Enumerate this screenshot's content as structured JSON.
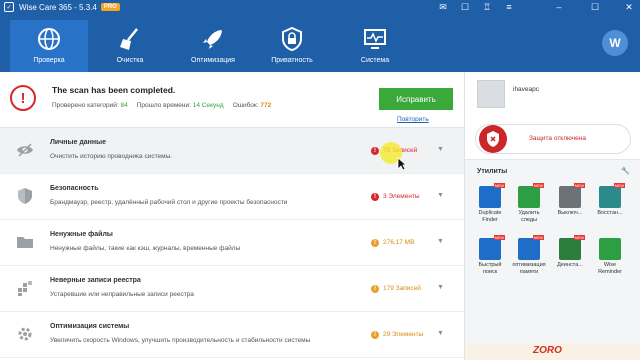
{
  "window": {
    "title": "Wise Care 365 - 5.3.4",
    "edition": "PRO",
    "controls": [
      "mail-icon",
      "chat-icon",
      "shirt-icon",
      "menu-icon",
      "minimize-icon",
      "maximize-icon",
      "close-icon"
    ]
  },
  "nav": {
    "tabs": [
      {
        "label": "Проверка",
        "icon": "globe-scan-icon",
        "active": true
      },
      {
        "label": "Очистка",
        "icon": "broom-icon",
        "active": false
      },
      {
        "label": "Оптимизация",
        "icon": "rocket-icon",
        "active": false
      },
      {
        "label": "Приватность",
        "icon": "lock-shield-icon",
        "active": false
      },
      {
        "label": "Система",
        "icon": "monitor-pulse-icon",
        "active": false
      }
    ],
    "brand_letter": "W"
  },
  "summary": {
    "title": "The scan has been completed.",
    "checked_label": "Проверено категорий:",
    "checked_value": "84",
    "time_label": "Прошло времени:",
    "time_value": "14 Секунд",
    "errors_label": "Ошибок:",
    "errors_value": "772",
    "fix_button": "Исправить",
    "rescan_link": "Повторить"
  },
  "categories": [
    {
      "title": "Личные данные",
      "desc": "Очистить историю проводника системы.",
      "count": "75 Записей",
      "severity": "red"
    },
    {
      "title": "Безопасность",
      "desc": "Брандмауэр, реестр, удалённый рабочий стол и другие проекты безопасности",
      "count": "3 Элементы",
      "severity": "red"
    },
    {
      "title": "Ненужные файлы",
      "desc": "Ненужные файлы, такие как кэш, журналы, временные файлы",
      "count": "276,17 MB",
      "severity": "orange"
    },
    {
      "title": "Неверные записи реестра",
      "desc": "Устаревшие или неправильные записи реестра",
      "count": "179 Записей",
      "severity": "orange"
    },
    {
      "title": "Оптимизация системы",
      "desc": "Увеличить скорость Windows, улучшить производительность и стабильности системы",
      "count": "29 Элементы",
      "severity": "orange"
    }
  ],
  "sidebar": {
    "username": "ihaveapc",
    "protection_status": "Защита отключена",
    "utilities_title": "Утилиты",
    "utilities": [
      {
        "label": "Duplicate Finder",
        "icon": "duplicate-finder-icon",
        "color": "#1e6ec8",
        "new": true
      },
      {
        "label": "Удалить следы",
        "icon": "eraser-icon",
        "color": "#2e9e44",
        "new": true
      },
      {
        "label": "Выключ...",
        "icon": "power-icon",
        "color": "#6c7378",
        "new": true
      },
      {
        "label": "Восстан...",
        "icon": "restore-icon",
        "color": "#2b8a8a",
        "new": true
      },
      {
        "label": "Быстрый поиск",
        "icon": "search-icon",
        "color": "#1e6ec8",
        "new": true
      },
      {
        "label": "оптимизация памяти",
        "icon": "memory-icon",
        "color": "#1e6ec8",
        "new": true
      },
      {
        "label": "Деинста...",
        "icon": "uninstall-icon",
        "color": "#2a7d3a",
        "new": true
      },
      {
        "label": "Wise Reminder",
        "icon": "reminder-icon",
        "color": "#2e9e44",
        "new": false
      }
    ],
    "banner_text": "ZORO"
  }
}
